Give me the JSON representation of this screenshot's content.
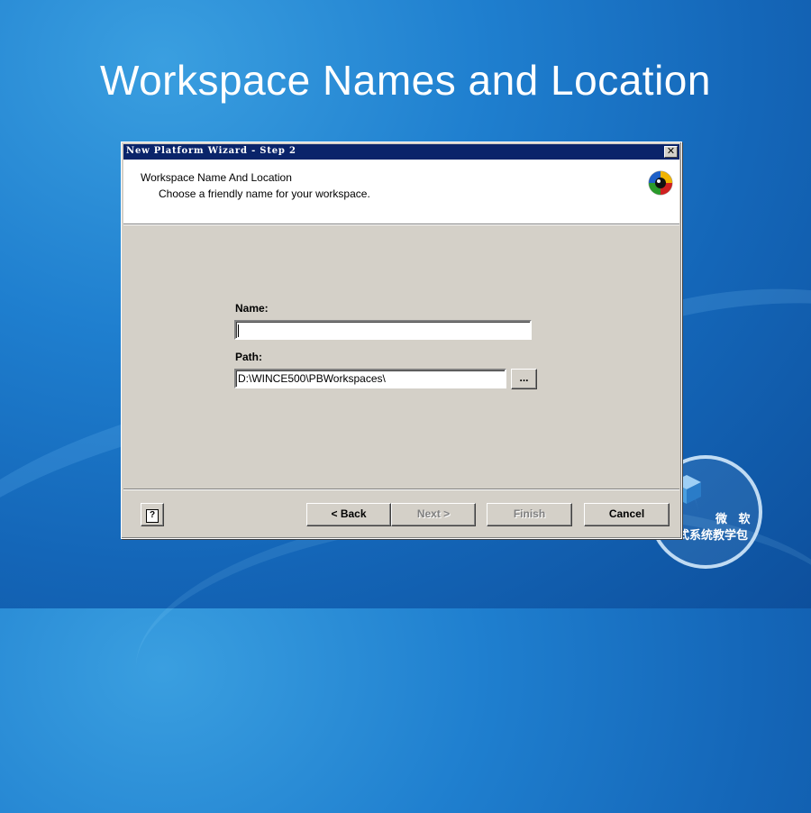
{
  "slide": {
    "title": "Workspace Names and Location",
    "logo_line1": "微 软",
    "logo_line2": "式系统教学包"
  },
  "dialog": {
    "title": "New Platform Wizard - Step 2",
    "close_glyph": "✕",
    "header_title": "Workspace Name And Location",
    "header_subtitle": "Choose a friendly name for your workspace.",
    "help_glyph": "?",
    "name_label": "Name:",
    "name_value": "",
    "path_label": "Path:",
    "path_value": "D:\\WINCE500\\PBWorkspaces\\",
    "browse_label": "...",
    "back_label": "< Back",
    "next_label": "Next >",
    "finish_label": "Finish",
    "cancel_label": "Cancel"
  },
  "colors": {
    "titlebar": "#0a246a",
    "dialog_face": "#d4d0c8",
    "slide_bg": "#1f7fcf"
  },
  "icons": [
    "close-icon",
    "wizard-logo-icon",
    "help-icon",
    "slide-logo-icon"
  ]
}
